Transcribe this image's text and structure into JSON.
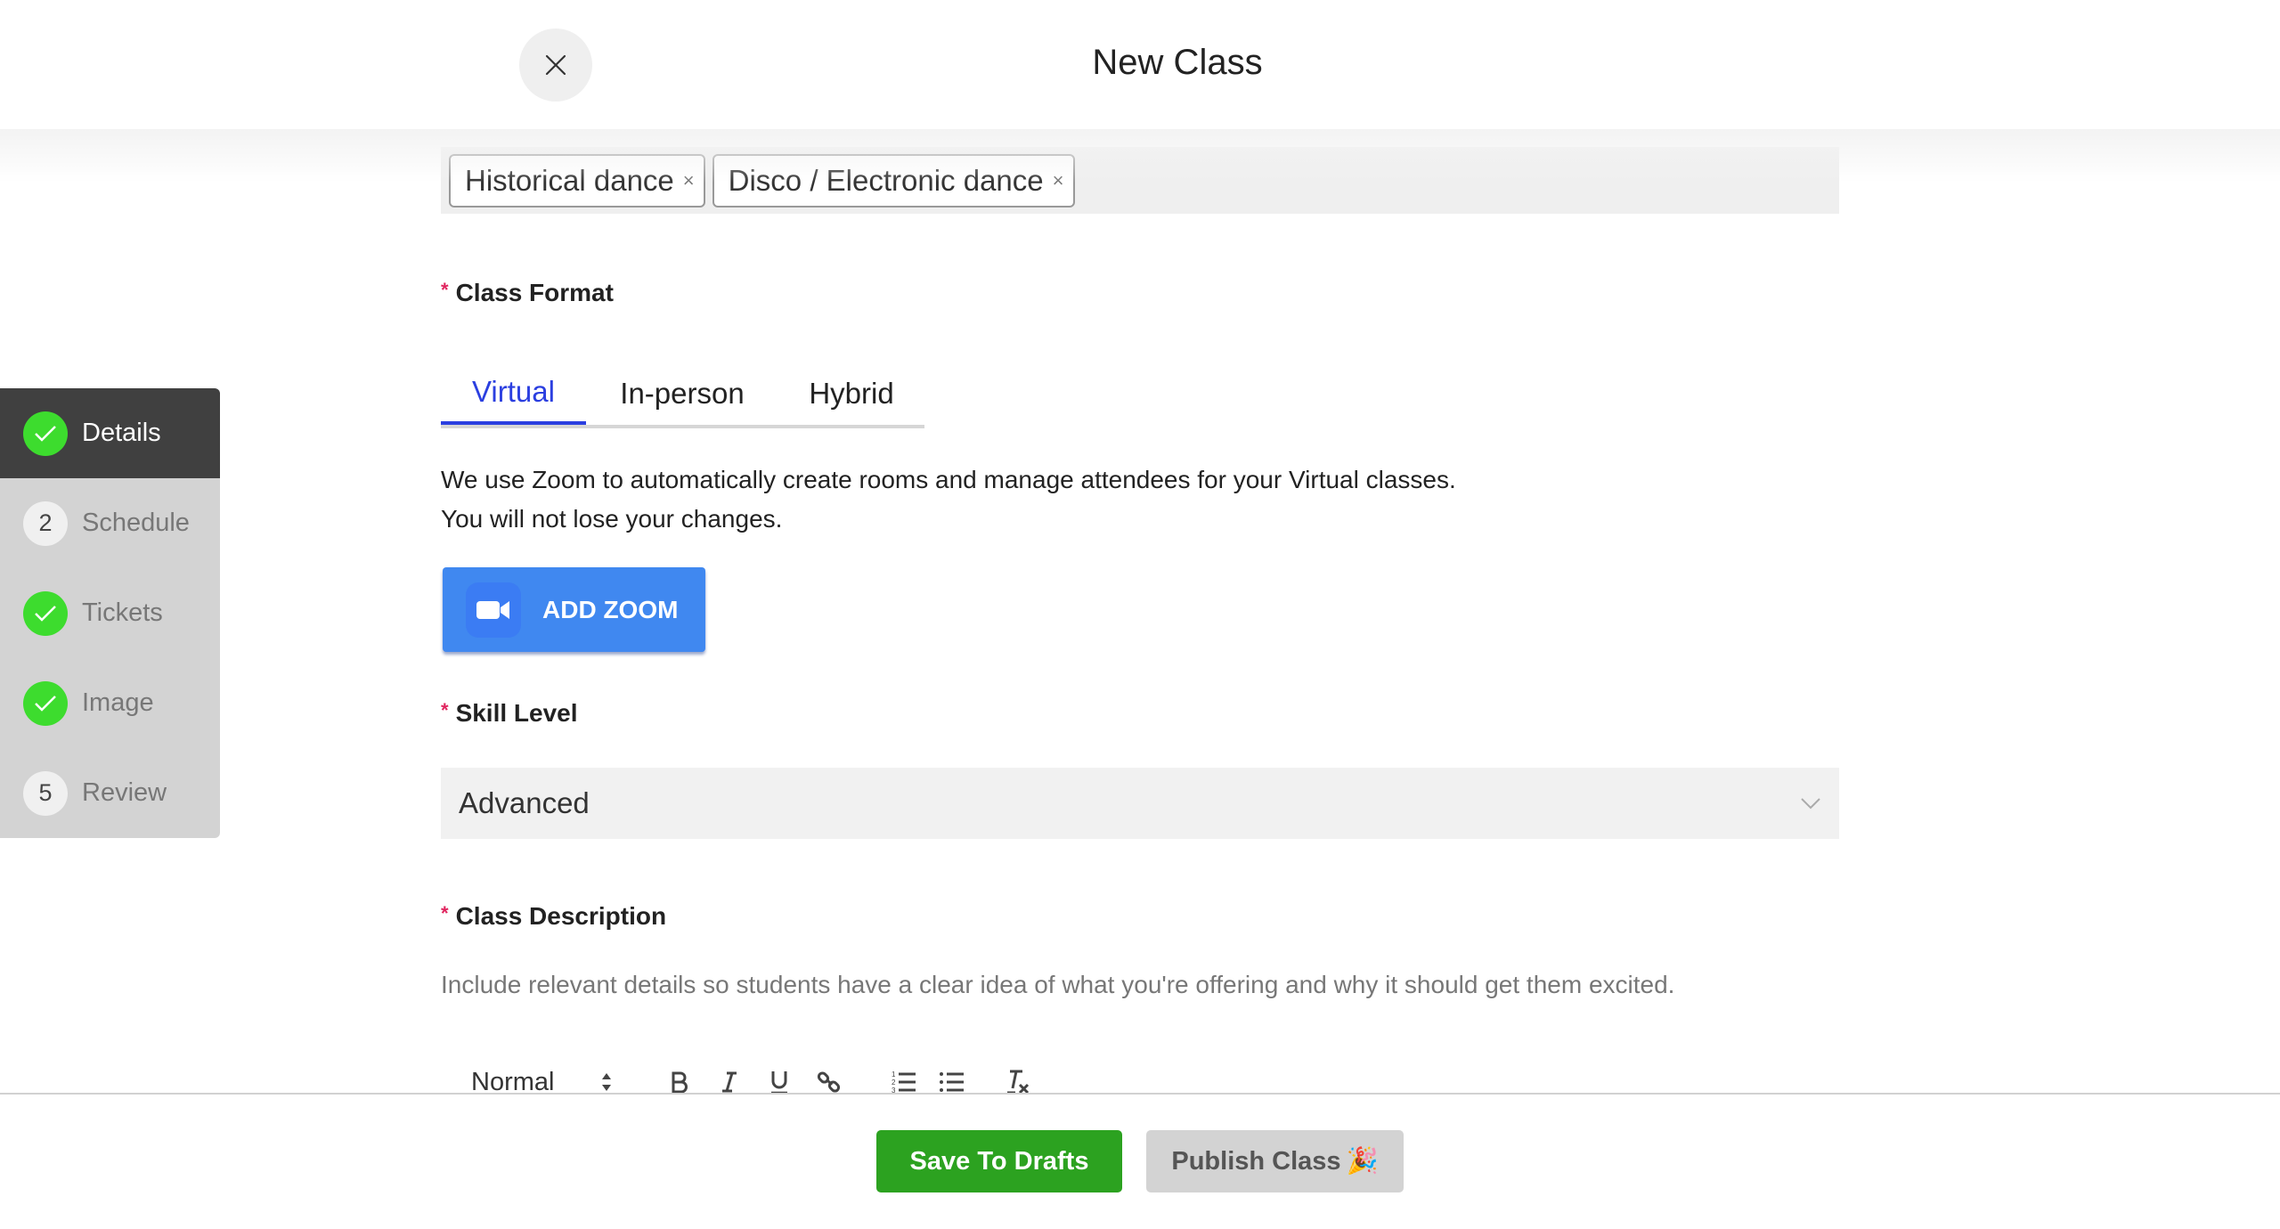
{
  "header": {
    "title": "New Class",
    "close_icon": "close-icon"
  },
  "tags": {
    "items": [
      {
        "label": "Historical dance",
        "remove": "×"
      },
      {
        "label": "Disco / Electronic dance",
        "remove": "×"
      }
    ]
  },
  "class_format": {
    "required_mark": "*",
    "label": "Class Format",
    "tabs": [
      {
        "label": "Virtual",
        "active": true
      },
      {
        "label": "In-person",
        "active": false
      },
      {
        "label": "Hybrid",
        "active": false
      }
    ],
    "description_line1": "We use Zoom to automatically create rooms and manage attendees for your Virtual classes.",
    "description_line2": "You will not lose your changes.",
    "add_zoom_label": "ADD ZOOM",
    "accent_color": "#2b3fe0",
    "zoom_color": "#4088f0"
  },
  "skill_level": {
    "required_mark": "*",
    "label": "Skill Level",
    "selected": "Advanced"
  },
  "class_description": {
    "required_mark": "*",
    "label": "Class Description",
    "helper": "Include relevant details so students have a clear idea of what you're offering and why it should get them excited.",
    "toolbar": {
      "format_select": "Normal",
      "buttons": [
        "bold",
        "italic",
        "underline",
        "link",
        "ordered-list",
        "bullet-list",
        "clear-format"
      ]
    }
  },
  "sidebar": {
    "steps": [
      {
        "label": "Details",
        "status": "done",
        "badge": "",
        "active": true
      },
      {
        "label": "Schedule",
        "status": "pending",
        "badge": "2",
        "active": false
      },
      {
        "label": "Tickets",
        "status": "done",
        "badge": "",
        "active": false
      },
      {
        "label": "Image",
        "status": "done",
        "badge": "",
        "active": false
      },
      {
        "label": "Review",
        "status": "pending",
        "badge": "5",
        "active": false
      }
    ]
  },
  "footer": {
    "save_label": "Save To Drafts",
    "publish_label": "Publish Class",
    "publish_emoji": "🎉",
    "save_color": "#2ca220"
  }
}
